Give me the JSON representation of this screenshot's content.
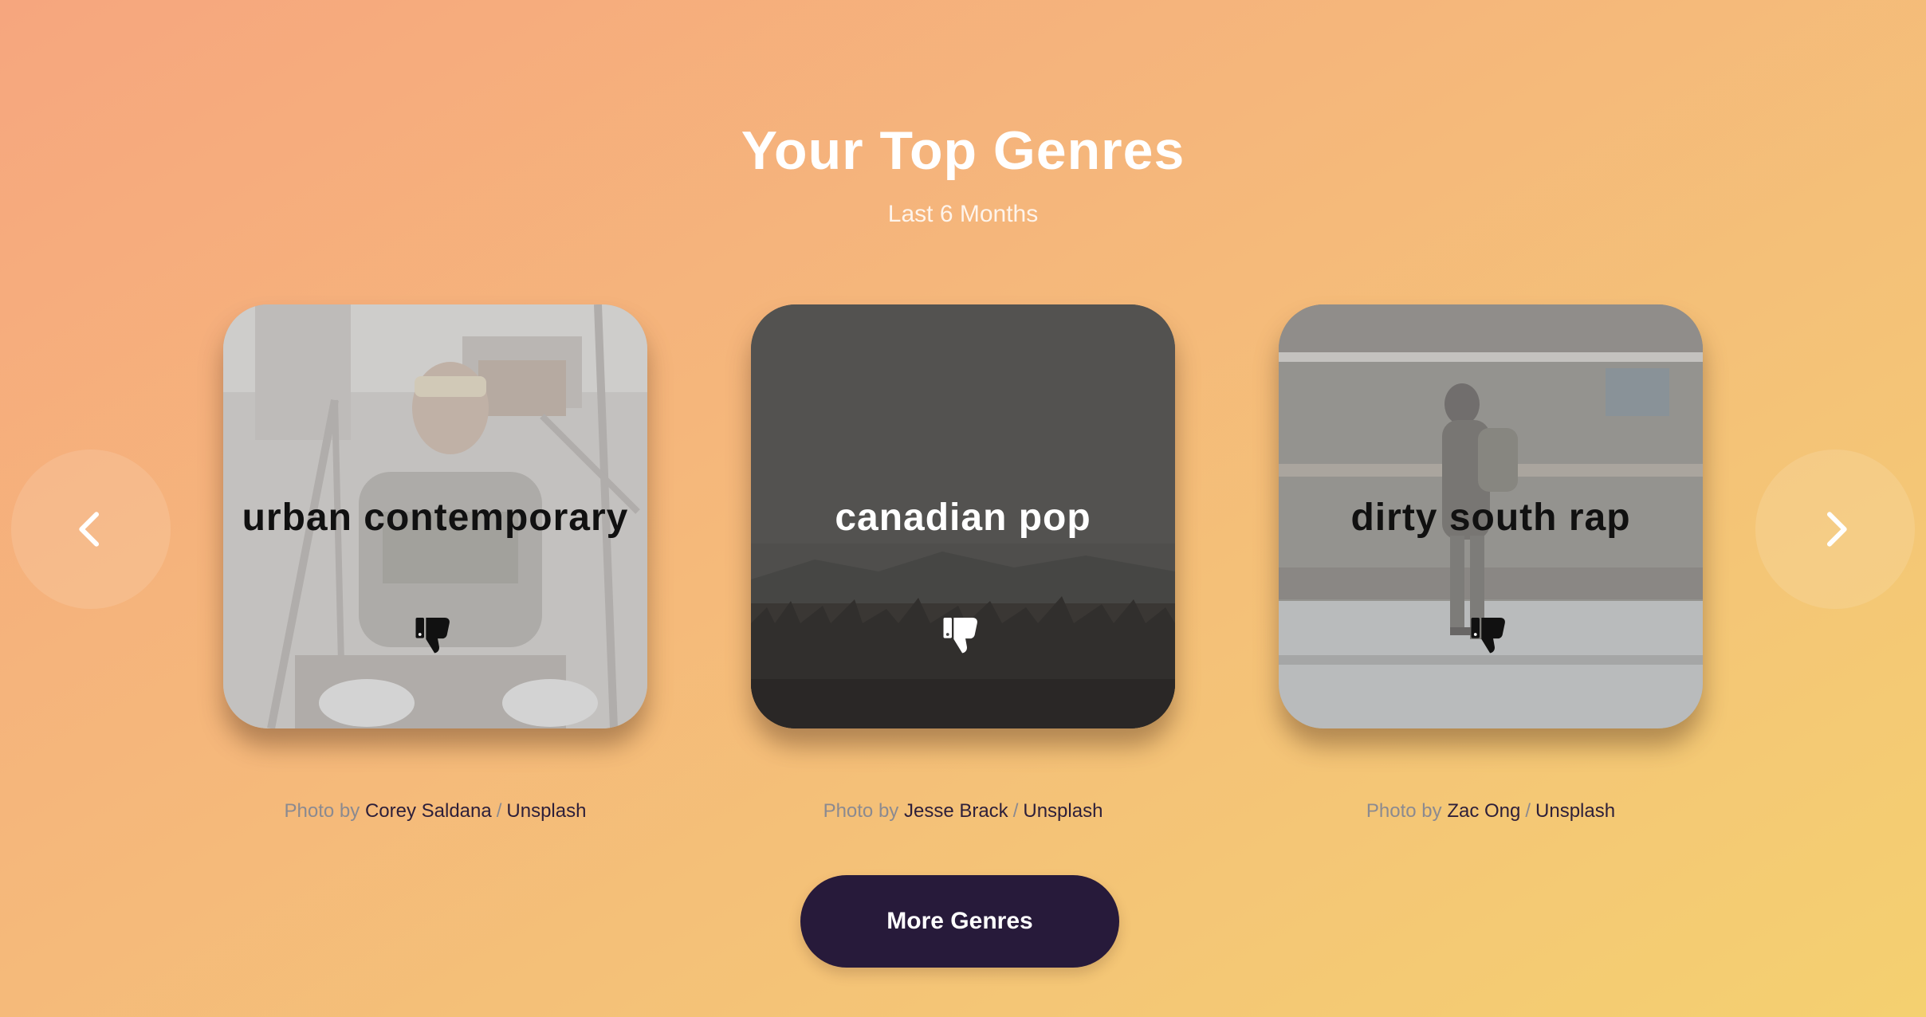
{
  "header": {
    "title": "Your Top Genres",
    "subtitle": "Last 6 Months"
  },
  "navigation": {
    "prev_icon": "chevron-left-icon",
    "next_icon": "chevron-right-icon"
  },
  "genres": [
    {
      "name": "urban contemporary",
      "name_color": "#111111",
      "dislike_icon": "thumbs-down-icon",
      "credit": {
        "prefix": "Photo by",
        "photographer": "Corey Saldana",
        "separator": "/",
        "source": "Unsplash"
      }
    },
    {
      "name": "canadian pop",
      "name_color": "#ffffff",
      "dislike_icon": "thumbs-down-icon",
      "credit": {
        "prefix": "Photo by",
        "photographer": "Jesse Brack",
        "separator": "/",
        "source": "Unsplash"
      }
    },
    {
      "name": "dirty south rap",
      "name_color": "#111111",
      "dislike_icon": "thumbs-down-icon",
      "credit": {
        "prefix": "Photo by",
        "photographer": "Zac Ong",
        "separator": "/",
        "source": "Unsplash"
      }
    }
  ],
  "actions": {
    "more_label": "More Genres"
  },
  "colors": {
    "button_bg": "#271a3a",
    "credit_link": "#2d1f3a",
    "credit_muted": "#8b8a90"
  }
}
